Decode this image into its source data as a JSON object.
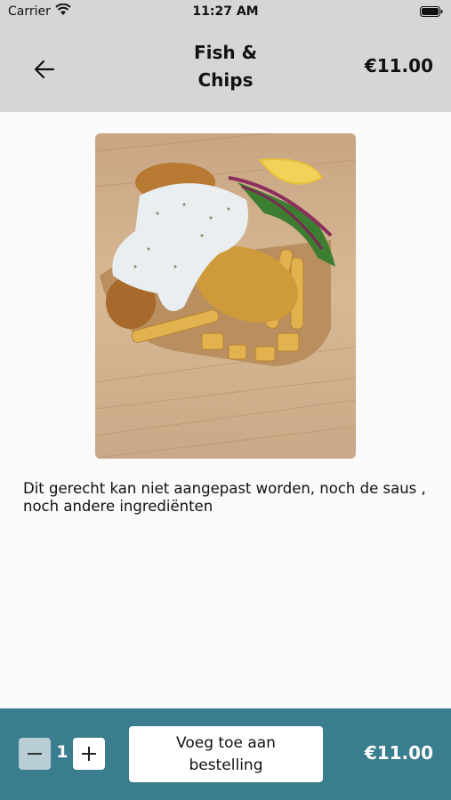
{
  "status_bar": {
    "carrier": "Carrier",
    "time": "11:27 AM"
  },
  "header": {
    "title_line1": "Fish &",
    "title_line2": "Chips",
    "price": "€11.00",
    "back_icon": "arrow-left-icon"
  },
  "content": {
    "image_alt": "Fish and chips with tartar sauce and salad",
    "description": "Dit gerecht kan niet aangepast worden, noch de saus , noch andere ingrediënten"
  },
  "footer": {
    "minus_label": "−",
    "quantity": "1",
    "plus_label": "+",
    "add_button_line1": "Voeg toe aan",
    "add_button_line2": "bestelling",
    "price": "€11.00"
  },
  "colors": {
    "header_bg": "#d6d6d6",
    "footer_bg": "#3a7d8e",
    "minus_button_bg": "#b8cdd4"
  }
}
